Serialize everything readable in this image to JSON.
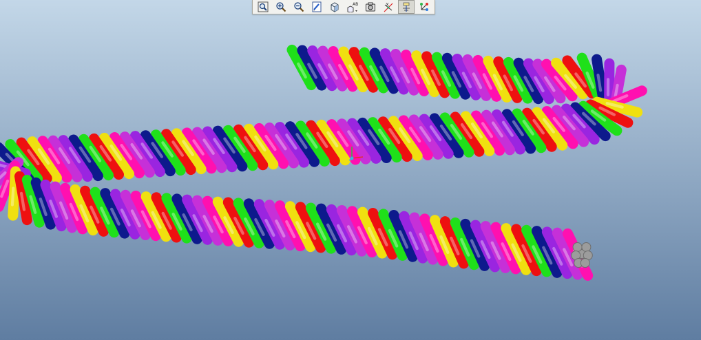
{
  "window": {
    "background_top": "#c3d7e8",
    "background_bottom": "#5f7da1"
  },
  "toolbar": {
    "buttons": [
      {
        "name": "zoom-refit",
        "icon": "zoom-refit-icon",
        "pressed": false
      },
      {
        "name": "zoom-in",
        "icon": "zoom-in-icon",
        "pressed": false
      },
      {
        "name": "zoom-out",
        "icon": "zoom-out-icon",
        "pressed": false
      },
      {
        "name": "repaint",
        "icon": "repaint-icon",
        "pressed": false
      },
      {
        "name": "display-style",
        "icon": "display-style-icon",
        "pressed": false
      },
      {
        "name": "saved-views",
        "icon": "saved-views-icon",
        "pressed": false
      },
      {
        "name": "view-manager",
        "icon": "camera-icon",
        "pressed": false
      },
      {
        "name": "datum-display",
        "icon": "datum-display-icon",
        "pressed": false
      },
      {
        "name": "annotation-display",
        "icon": "annotation-display-icon",
        "pressed": true
      },
      {
        "name": "spin-center",
        "icon": "spin-center-icon",
        "pressed": false
      }
    ],
    "ab_label": "AB",
    "xx_label": "X"
  },
  "model": {
    "name": "twisted-rope-helix",
    "strand_colors": [
      "#1fe01a",
      "#0d1a8c",
      "#9a25e0",
      "#c630d8",
      "#ff10b0",
      "#f0e010",
      "#ee1010"
    ],
    "end_cap_color": "#9c9c9c",
    "triad_colors": [
      "#e23030",
      "#2fb84a",
      "#35b8e0"
    ]
  }
}
